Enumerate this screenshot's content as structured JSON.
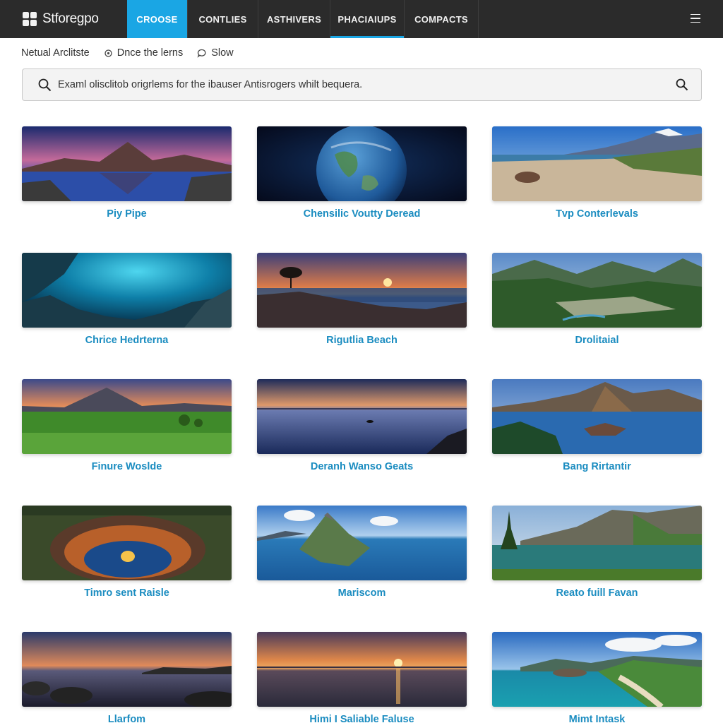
{
  "brand": {
    "name": "Stforegpo",
    "logo_icon": "grid-logo-icon"
  },
  "nav": {
    "tabs": [
      {
        "label": "CROOSE",
        "state": "active"
      },
      {
        "label": "CONTLIES",
        "state": "normal"
      },
      {
        "label": "ASTHIVERS",
        "state": "normal"
      },
      {
        "label": "PHACIAIUPS",
        "state": "underlined"
      },
      {
        "label": "COMPACTS",
        "state": "normal"
      }
    ],
    "menu_icon": "hamburger-icon"
  },
  "subbar": {
    "items": [
      {
        "label": "Netual Arclitste",
        "icon": ""
      },
      {
        "label": "Dnce the lerns",
        "icon": "settings-icon"
      },
      {
        "label": "Slow",
        "icon": "chat-bubble-icon"
      }
    ]
  },
  "search": {
    "placeholder": "Examl olisclitob origrlems for the ibauser Antisrogers whilt bequera.",
    "value": ""
  },
  "colors": {
    "accent": "#1aa6e4",
    "caption": "#1a8cc0",
    "topbar": "#2b2b2b"
  },
  "gallery": {
    "items": [
      {
        "caption": "Piy Pipe",
        "scene": "mountain-lake-night"
      },
      {
        "caption": "Chensilic Voutty Deread",
        "scene": "earth-from-space"
      },
      {
        "caption": "Tvp Conterlevals",
        "scene": "beach-mountains"
      },
      {
        "caption": "Chrice Hedrterna",
        "scene": "underwater-cave"
      },
      {
        "caption": "Rigutlia Beach",
        "scene": "sunset-coast-tree"
      },
      {
        "caption": "Drolitaial",
        "scene": "mountain-valley"
      },
      {
        "caption": "Finure Woslde",
        "scene": "meadow-sunset-peak"
      },
      {
        "caption": "Deranh Wanso Geats",
        "scene": "calm-lake-dusk"
      },
      {
        "caption": "Bang Rirtantir",
        "scene": "mountain-lake-island"
      },
      {
        "caption": "Timro sent Raisle",
        "scene": "glowing-sinkhole"
      },
      {
        "caption": "Mariscom",
        "scene": "island-peak-sea"
      },
      {
        "caption": "Reato fuill Favan",
        "scene": "alpine-lake"
      },
      {
        "caption": "Llarfom",
        "scene": "sunset-rocks-lake"
      },
      {
        "caption": "Himi I Saliable Faluse",
        "scene": "sea-sunset"
      },
      {
        "caption": "Mimt Intask",
        "scene": "tropical-bay"
      }
    ]
  }
}
